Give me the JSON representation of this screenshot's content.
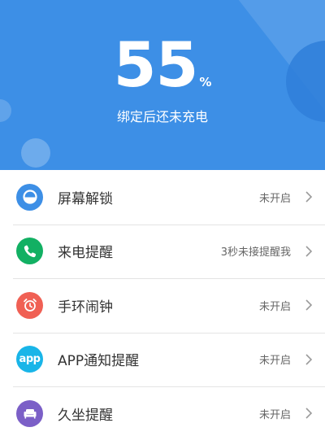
{
  "header": {
    "percent_value": "55",
    "percent_unit": "%",
    "status": "绑定后还未充电",
    "background_color": "#3d8fe6"
  },
  "items": [
    {
      "label": "屏幕解锁",
      "status": "未开启",
      "icon": "unlock-icon",
      "color": "#3d8fe6"
    },
    {
      "label": "来电提醒",
      "status": "3秒未接提醒我",
      "icon": "phone-icon",
      "color": "#12b063"
    },
    {
      "label": "手环闹钟",
      "status": "未开启",
      "icon": "alarm-clock-icon",
      "color": "#f06054"
    },
    {
      "label": "APP通知提醒",
      "status": "未开启",
      "icon": "app-icon",
      "color": "#19b5e8",
      "icon_text": "app"
    },
    {
      "label": "久坐提醒",
      "status": "未开启",
      "icon": "sofa-icon",
      "color": "#7b5fc7"
    }
  ]
}
